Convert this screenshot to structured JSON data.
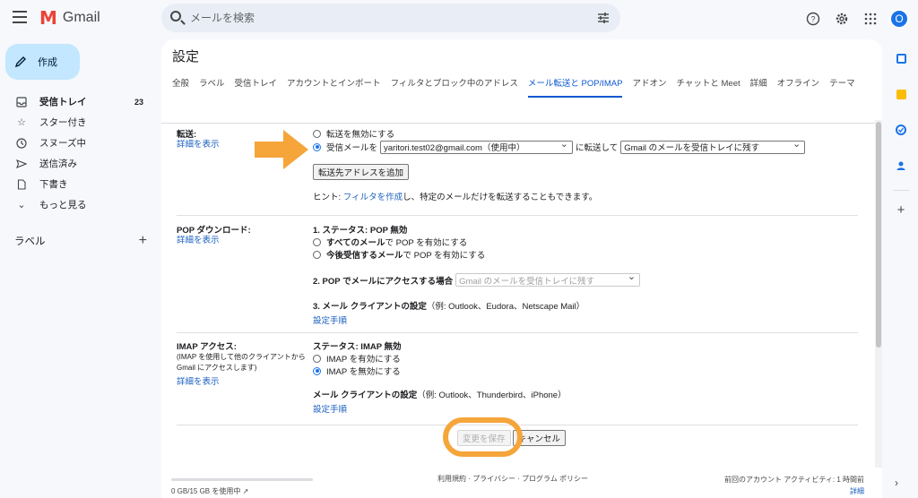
{
  "app": {
    "name": "Gmail"
  },
  "search": {
    "placeholder": "メールを検索"
  },
  "sidebar": {
    "compose_label": "作成",
    "items": [
      {
        "icon": "inbox-icon",
        "label": "受信トレイ",
        "count": "23",
        "bold": true
      },
      {
        "icon": "star-icon",
        "label": "スター付き"
      },
      {
        "icon": "clock-icon",
        "label": "スヌーズ中"
      },
      {
        "icon": "send-icon",
        "label": "送信済み"
      },
      {
        "icon": "draft-icon",
        "label": "下書き"
      },
      {
        "icon": "chevron-down-icon",
        "label": "もっと見る"
      }
    ],
    "labels_heading": "ラベル"
  },
  "settings": {
    "title": "設定",
    "tabs": [
      "全般",
      "ラベル",
      "受信トレイ",
      "アカウントとインポート",
      "フィルタとブロック中のアドレス",
      "メール転送と POP/IMAP",
      "アドオン",
      "チャットと Meet",
      "詳細",
      "オフライン",
      "テーマ"
    ],
    "active_tab": "メール転送と POP/IMAP",
    "forwarding": {
      "title": "転送:",
      "details_link": "詳細を表示",
      "disable_label": "転送を無効にする",
      "forward_prefix": "受信メールを",
      "forward_address": "yaritori.test02@gmail.com（使用中）",
      "forward_mid": "に転送して",
      "forward_action": "Gmail のメールを受信トレイに残す",
      "add_address_button": "転送先アドレスを追加",
      "hint_prefix": "ヒント: ",
      "hint_link": "フィルタを作成",
      "hint_suffix": "し、特定のメールだけを転送することもできます。"
    },
    "pop": {
      "title": "POP ダウンロード:",
      "details_link": "詳細を表示",
      "status": "1. ステータス: POP 無効",
      "opt_all_bold": "すべてのメール",
      "opt_all_rest": "で POP を有効にする",
      "opt_new_bold": "今後受信するメール",
      "opt_new_rest": "で POP を有効にする",
      "when_access": "2. POP でメールにアクセスする場合",
      "when_access_select": "Gmail のメールを受信トレイに残す",
      "client_bold": "3. メール クライアントの設定",
      "client_rest": "（例: Outlook、Eudora、Netscape Mail）",
      "setup_link": "設定手順"
    },
    "imap": {
      "title": "IMAP アクセス:",
      "sub": "(IMAP を使用して他のクライアントから Gmail にアクセスします)",
      "details_link": "詳細を表示",
      "status": "ステータス: IMAP 無効",
      "enable_label": "IMAP を有効にする",
      "disable_label": "IMAP を無効にする",
      "client_bold": "メール クライアントの設定",
      "client_rest": "（例: Outlook、Thunderbird、iPhone）",
      "setup_link": "設定手順"
    },
    "save_button": "変更を保存",
    "cancel_button": "キャンセル"
  },
  "footer": {
    "policies": "利用規約 · プライバシー · プログラム ポリシー",
    "last_activity": "前回のアカウント アクティビティ: 1 時間前",
    "details": "詳細",
    "storage": "0 GB/15 GB を使用中"
  },
  "account": {
    "avatar_letter": "O"
  },
  "colors": {
    "accent": "#0b57d0",
    "compose_bg": "#c2e7ff",
    "annotation": "#f5a53a"
  }
}
